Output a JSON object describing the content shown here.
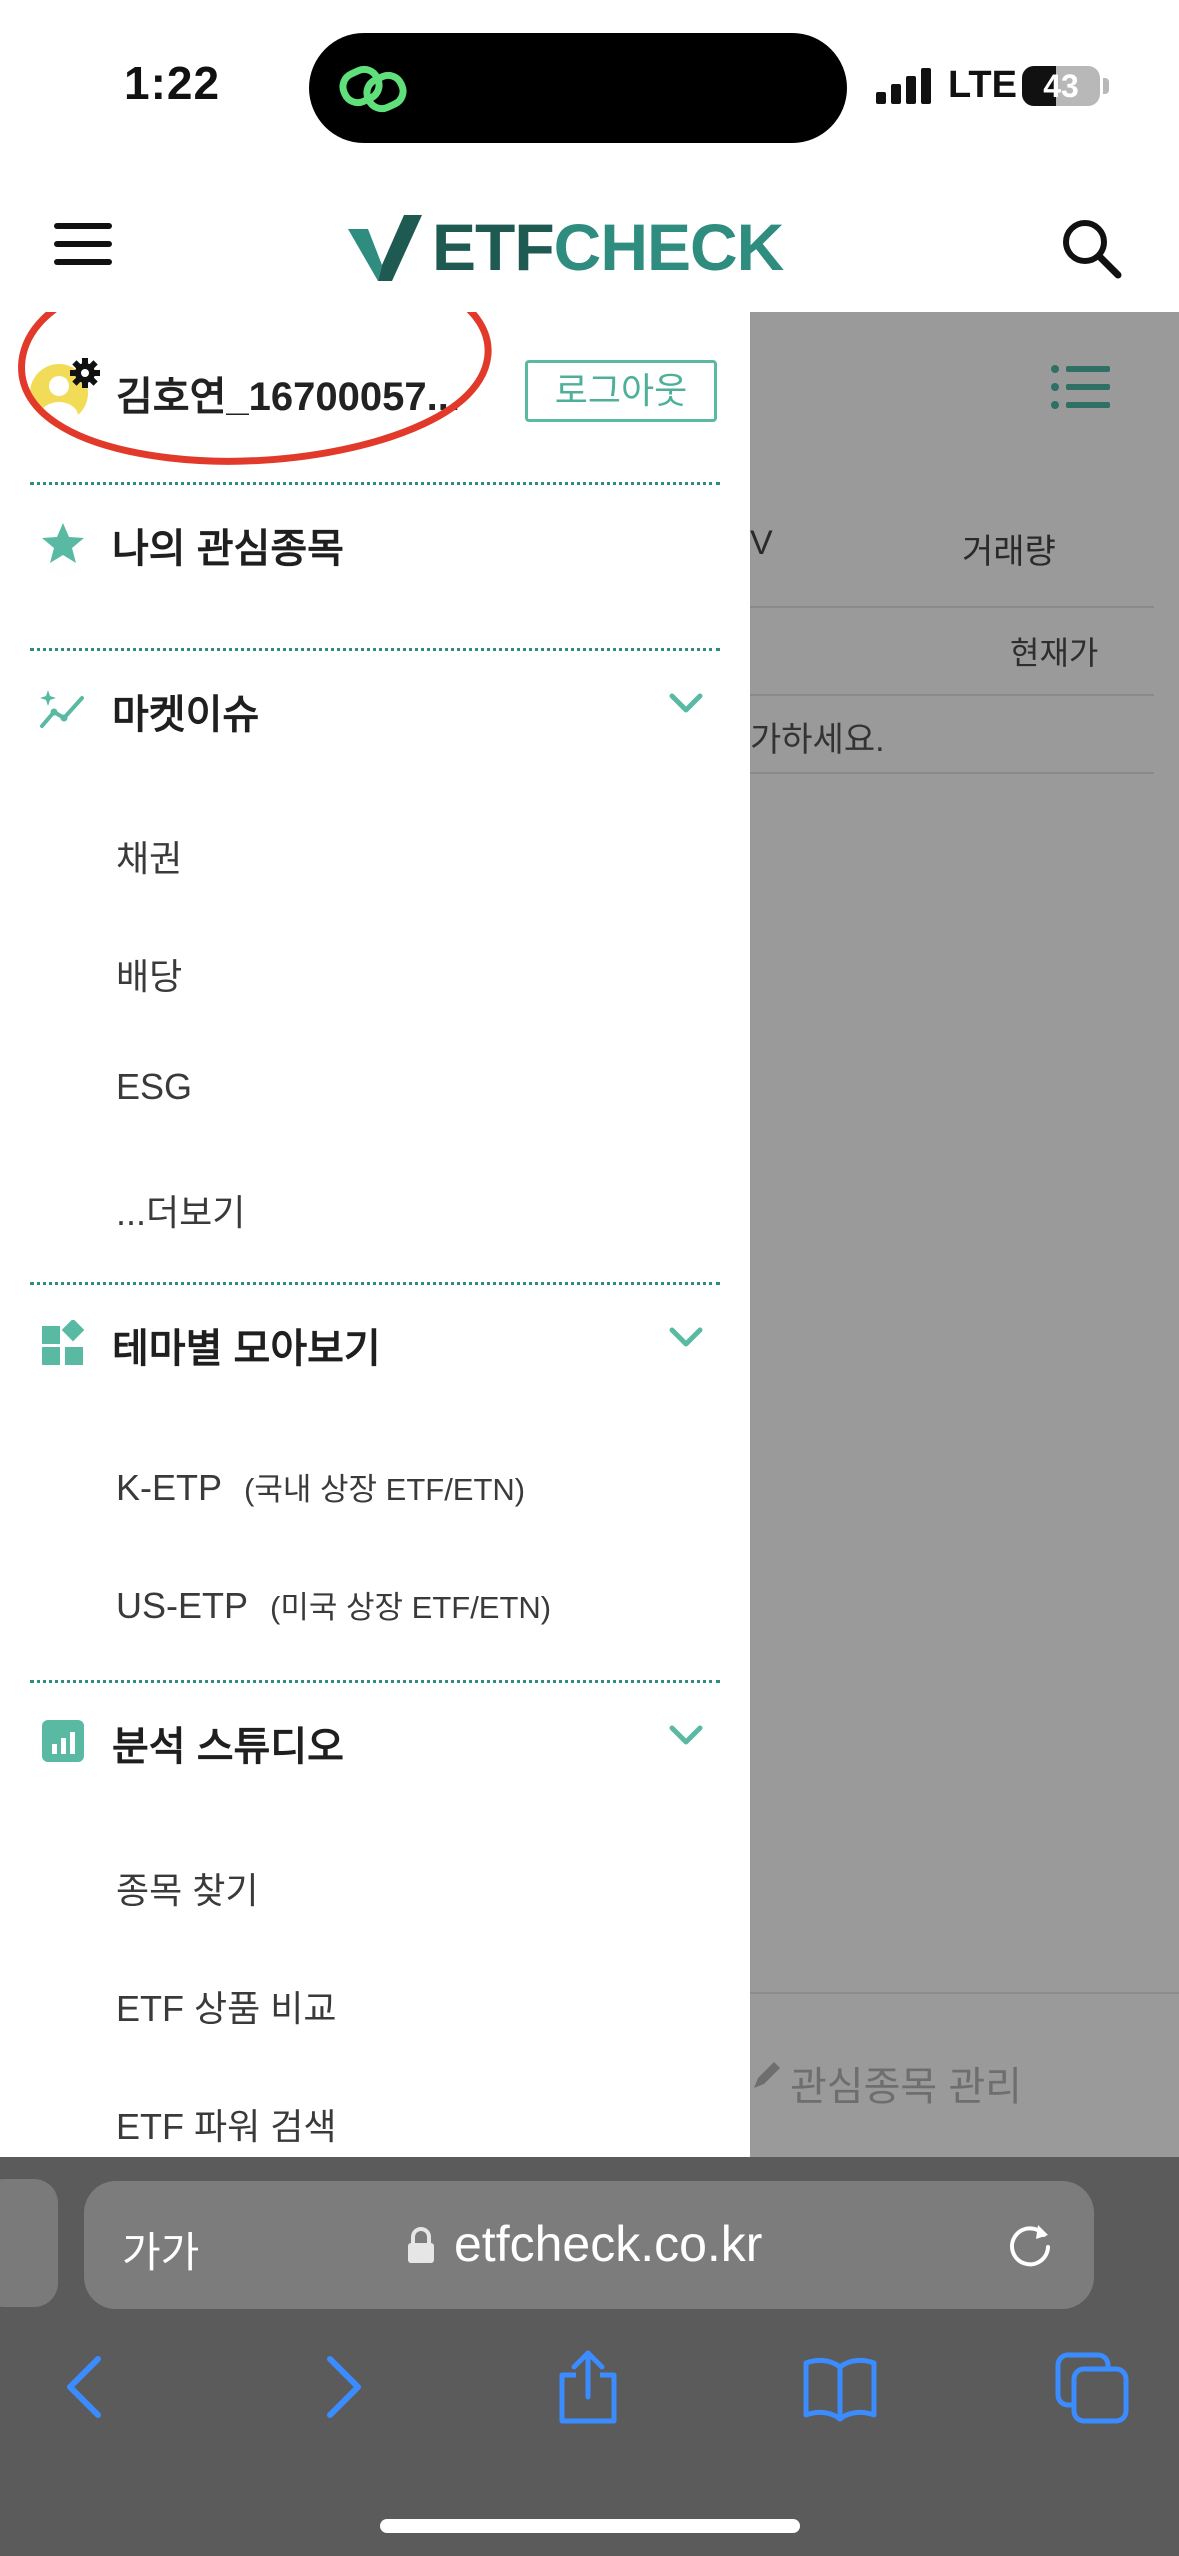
{
  "status_bar": {
    "time": "1:22",
    "network": "LTE",
    "battery_level": "43"
  },
  "header": {
    "logo_part1": "ETF",
    "logo_part2": "CHECK",
    "icons": [
      "menu-icon",
      "search-icon"
    ]
  },
  "drawer": {
    "username": "김호연_16700057...",
    "logout_label": "로그아웃",
    "favorites_label": "나의 관심종목",
    "sections": [
      {
        "title": "마켓이슈",
        "items": [
          "채권",
          "배당",
          "ESG",
          "...더보기"
        ]
      },
      {
        "title": "테마별 모아보기",
        "items": [
          {
            "label": "K-ETP",
            "note": "(국내 상장 ETF/ETN)"
          },
          {
            "label": "US-ETP",
            "note": "(미국 상장 ETF/ETN)"
          }
        ]
      },
      {
        "title": "분석 스튜디오",
        "items": [
          "종목 찾기",
          "ETF 상품 비교",
          "ETF 파워 검색"
        ]
      }
    ]
  },
  "background_page": {
    "col_partial": "V",
    "col_volume": "거래량",
    "col_price": "현재가",
    "empty_message": "가하세요.",
    "manage_label": "관심종목 관리"
  },
  "browser": {
    "text_size_label": "가가",
    "url": "etfcheck.co.kr"
  },
  "colors": {
    "brand_dark": "#1f5a52",
    "brand": "#2f8d7f",
    "accent_green": "#5ab9a3",
    "annotation_red": "#e23a2a"
  }
}
